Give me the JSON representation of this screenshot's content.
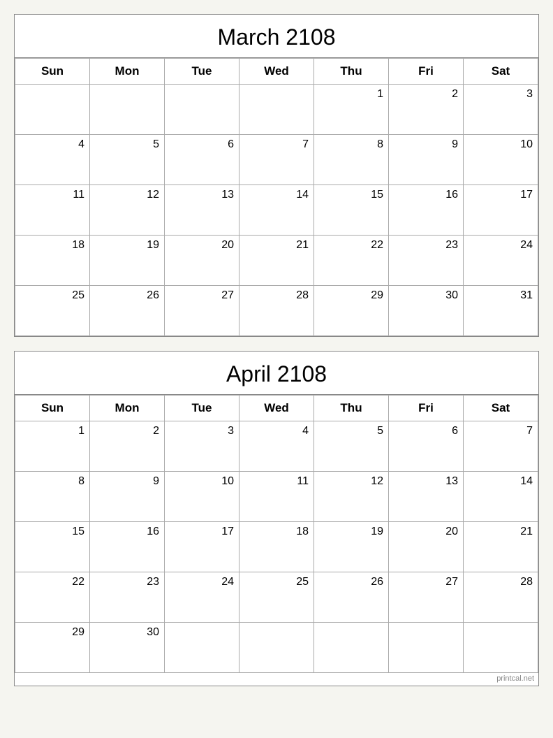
{
  "march": {
    "title": "March 2108",
    "days_header": [
      "Sun",
      "Mon",
      "Tue",
      "Wed",
      "Thu",
      "Fri",
      "Sat"
    ],
    "weeks": [
      [
        "",
        "",
        "",
        "",
        "1",
        "2",
        "3"
      ],
      [
        "4",
        "5",
        "6",
        "7",
        "8",
        "9",
        "10"
      ],
      [
        "11",
        "12",
        "13",
        "14",
        "15",
        "16",
        "17"
      ],
      [
        "18",
        "19",
        "20",
        "21",
        "22",
        "23",
        "24"
      ],
      [
        "25",
        "26",
        "27",
        "28",
        "29",
        "30",
        "31"
      ]
    ]
  },
  "april": {
    "title": "April 2108",
    "days_header": [
      "Sun",
      "Mon",
      "Tue",
      "Wed",
      "Thu",
      "Fri",
      "Sat"
    ],
    "weeks": [
      [
        "1",
        "2",
        "3",
        "4",
        "5",
        "6",
        "7"
      ],
      [
        "8",
        "9",
        "10",
        "11",
        "12",
        "13",
        "14"
      ],
      [
        "15",
        "16",
        "17",
        "18",
        "19",
        "20",
        "21"
      ],
      [
        "22",
        "23",
        "24",
        "25",
        "26",
        "27",
        "28"
      ],
      [
        "29",
        "30",
        "",
        "",
        "",
        "",
        ""
      ]
    ]
  },
  "watermark": "printcal.net"
}
